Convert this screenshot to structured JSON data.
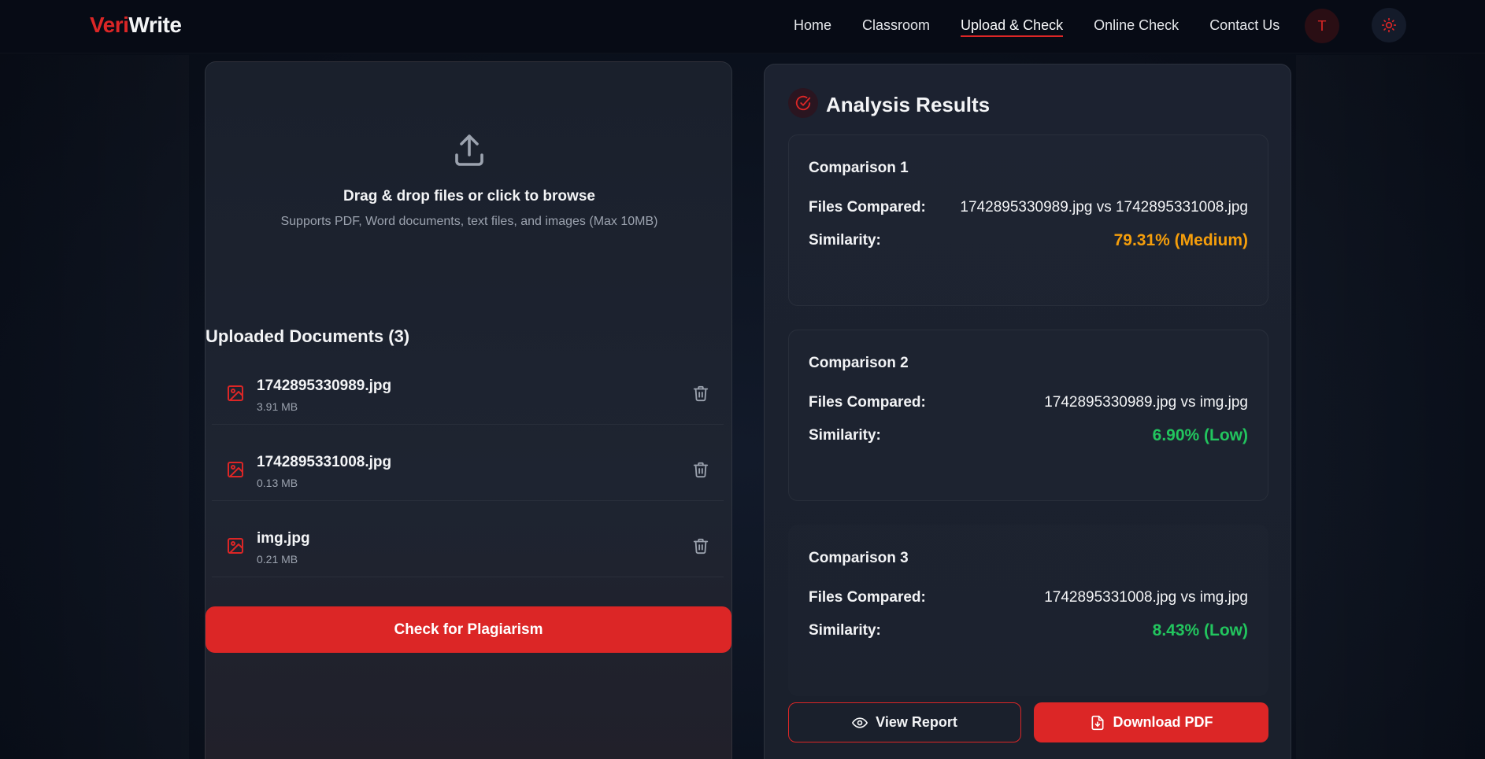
{
  "brand": {
    "name_part1": "Veri",
    "name_part2": "Write",
    "accent": "#dc2626"
  },
  "nav": {
    "items": [
      {
        "label": "Home",
        "active": false
      },
      {
        "label": "Classroom",
        "active": false
      },
      {
        "label": "Upload & Check",
        "active": true
      },
      {
        "label": "Online Check",
        "active": false
      },
      {
        "label": "Contact Us",
        "active": false
      }
    ],
    "avatar_initial": "T",
    "theme_icon": "sun-icon"
  },
  "upload": {
    "icon": "upload-icon",
    "title": "Drag & drop files or click to browse",
    "subtitle": "Supports PDF, Word documents, text files, and images (Max 10MB)"
  },
  "documents": {
    "heading": "Uploaded Documents (3)",
    "items": [
      {
        "name": "1742895330989.jpg",
        "size": "3.91 MB",
        "icon": "image-file-icon"
      },
      {
        "name": "1742895331008.jpg",
        "size": "0.13 MB",
        "icon": "image-file-icon"
      },
      {
        "name": "img.jpg",
        "size": "0.21 MB",
        "icon": "image-file-icon"
      }
    ],
    "check_button": "Check for Plagiarism"
  },
  "results": {
    "title": "Analysis Results",
    "files_label": "Files Compared:",
    "similarity_label": "Similarity:",
    "comparisons": [
      {
        "title": "Comparison 1",
        "files": "1742895330989.jpg vs 1742895331008.jpg",
        "similarity": "79.31% (Medium)",
        "color": "#f59e0b"
      },
      {
        "title": "Comparison 2",
        "files": "1742895330989.jpg vs img.jpg",
        "similarity": "6.90% (Low)",
        "color": "#22c55e"
      },
      {
        "title": "Comparison 3",
        "files": "1742895331008.jpg vs img.jpg",
        "similarity": "8.43% (Low)",
        "color": "#22c55e"
      }
    ],
    "view_report": "View Report",
    "download_pdf": "Download PDF"
  }
}
